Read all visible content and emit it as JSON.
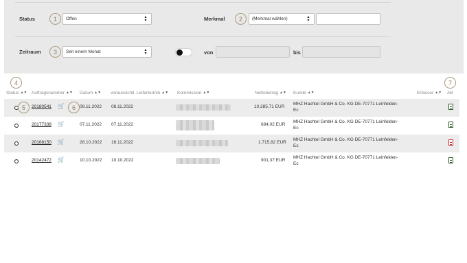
{
  "filters": {
    "status_label": "Status",
    "status_value": "Offen",
    "merkmal_label": "Merkmal",
    "merkmal_value": "(Merkmal wählen)",
    "zeitraum_label": "Zeitraum",
    "zeitraum_value": "Seit einem Monat",
    "von_label": "von",
    "bis_label": "bis"
  },
  "markers": [
    "1",
    "2",
    "3",
    "4",
    "5",
    "6",
    "7"
  ],
  "table": {
    "columns": [
      "Status",
      "Auftragsnummer",
      "Datum",
      "voraussichtl. Liefertermin",
      "Kommission",
      "Nettobetrag",
      "Kunde",
      "Erfasser",
      "AB"
    ],
    "rows": [
      {
        "order": "20180541",
        "date": "08.11.2022",
        "delivery": "08.11.2022",
        "net": "10.285,71 EUR",
        "customer_line1": "MHZ Hachtel GmbH & Co. KG DE-70771 Leinfelden-",
        "customer_line2": "Ec",
        "pdf": "green"
      },
      {
        "order": "20177338",
        "date": "07.11.2022",
        "delivery": "07.11.2022",
        "net": "684,02 EUR",
        "customer_line1": "MHZ Hachtel GmbH & Co. KG DE-70771 Leinfelden-",
        "customer_line2": "Ec",
        "pdf": "green"
      },
      {
        "order": "20168150",
        "date": "28.10.2022",
        "delivery": "16.11.2022",
        "net": "1.715,82 EUR",
        "customer_line1": "MHZ Hachtel GmbH & Co. KG DE-70771 Leinfelden-",
        "customer_line2": "Ec",
        "pdf": "red"
      },
      {
        "order": "20142472",
        "date": "10.10.2022",
        "delivery": "10.10.2022",
        "net": "901,37 EUR",
        "customer_line1": "MHZ Hachtel GmbH & Co. KG DE-70771 Leinfelden-",
        "customer_line2": "Ec",
        "pdf": "green"
      }
    ]
  },
  "icons": {
    "cart": "shopping-cart-icon",
    "pdf": "pdf-document-icon",
    "sort": "sort-arrows-icon"
  },
  "colors": {
    "panel": "#e9e9e9",
    "marker": "#a99a7c",
    "pdf_green": "#2f5f2f",
    "pdf_red": "#cc3333"
  }
}
